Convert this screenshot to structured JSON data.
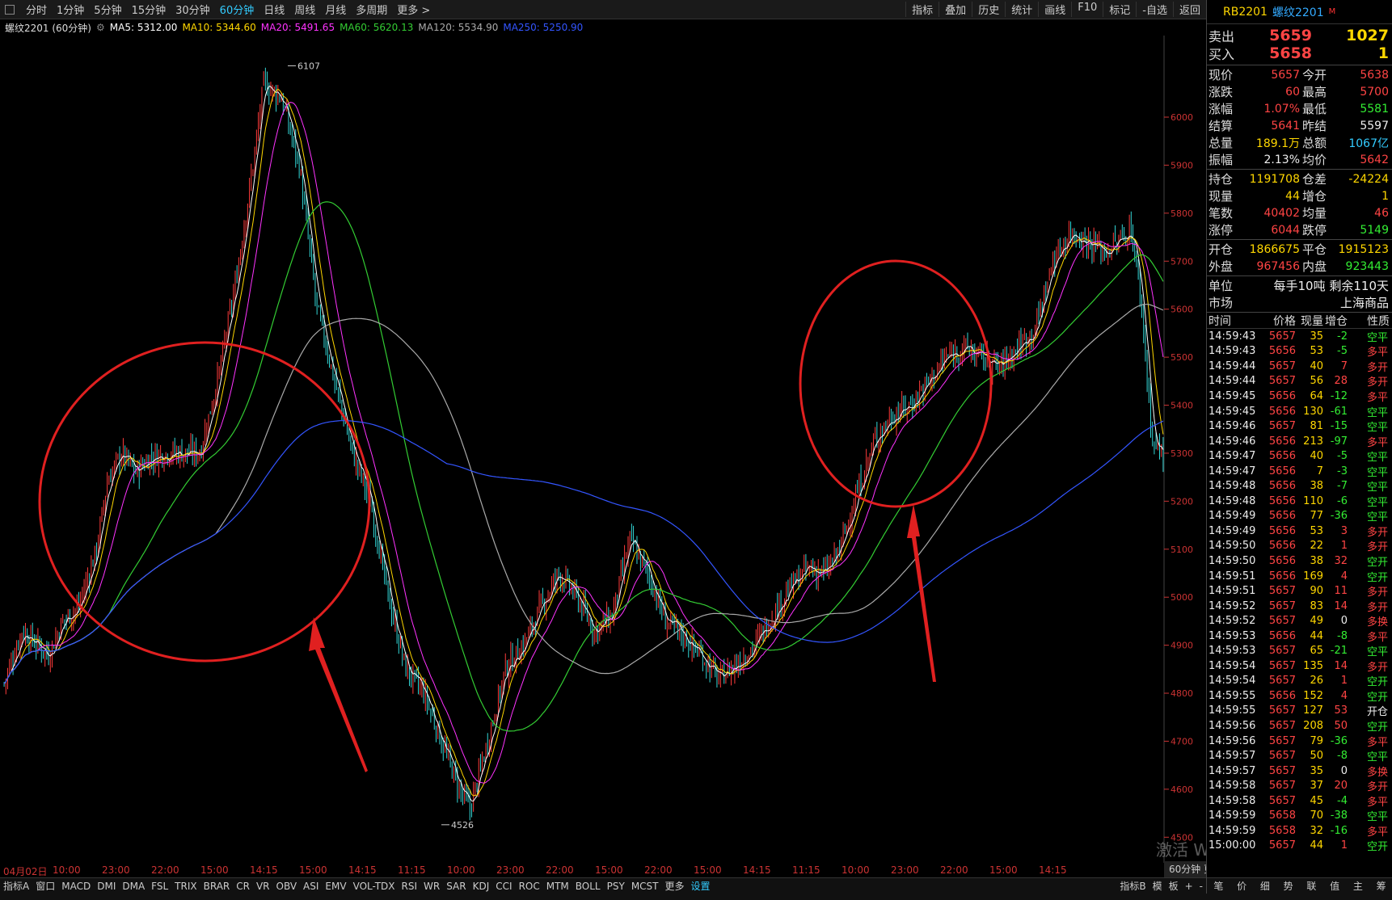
{
  "toolbar": {
    "timeframes": [
      "分时",
      "1分钟",
      "5分钟",
      "15分钟",
      "30分钟",
      "60分钟",
      "日线",
      "周线",
      "月线",
      "多周期",
      "更多 >"
    ],
    "active_timeframe": "60分钟",
    "tools": [
      "指标",
      "叠加",
      "历史",
      "统计",
      "画线",
      "F10",
      "标记",
      "-自选",
      "返回"
    ]
  },
  "infobar": {
    "symbol": "螺纹2201 (60分钟)",
    "ma5": "MA5: 5312.00",
    "ma10": "MA10: 5344.60",
    "ma20": "MA20: 5491.65",
    "ma60": "MA60: 5620.13",
    "ma120": "MA120: 5534.90",
    "ma250": "MA250: 5250.90",
    "colors": {
      "ma5": "#ffffff",
      "ma10": "#ffd700",
      "ma20": "#ff33ff",
      "ma60": "#33cc33",
      "ma120": "#aaaaaa",
      "ma250": "#3355ff"
    }
  },
  "chart_data": {
    "type": "candlestick",
    "ylim": [
      4450,
      6170
    ],
    "yticks": [
      4500,
      4600,
      4700,
      4800,
      4900,
      5000,
      5100,
      5200,
      5300,
      5400,
      5500,
      5600,
      5700,
      5800,
      5900,
      6000
    ],
    "xticks": [
      "04月02日",
      "10:00",
      "23:00",
      "22:00",
      "15:00",
      "14:15",
      "15:00",
      "14:15",
      "11:15",
      "10:00",
      "23:00",
      "22:00",
      "15:00",
      "22:00",
      "15:00",
      "14:15",
      "11:15",
      "10:00",
      "23:00",
      "22:00",
      "15:00",
      "14:15"
    ],
    "close_path": [
      [
        0,
        4820
      ],
      [
        10,
        4930
      ],
      [
        25,
        4880
      ],
      [
        33,
        4950
      ],
      [
        42,
        4980
      ],
      [
        52,
        5100
      ],
      [
        58,
        5240
      ],
      [
        66,
        5300
      ],
      [
        74,
        5260
      ],
      [
        82,
        5290
      ],
      [
        92,
        5300
      ],
      [
        110,
        5300
      ],
      [
        120,
        5450
      ],
      [
        130,
        5650
      ],
      [
        140,
        5900
      ],
      [
        146,
        6070
      ],
      [
        156,
        6040
      ],
      [
        166,
        5900
      ],
      [
        176,
        5600
      ],
      [
        186,
        5450
      ],
      [
        196,
        5300
      ],
      [
        206,
        5200
      ],
      [
        216,
        5000
      ],
      [
        226,
        4850
      ],
      [
        236,
        4800
      ],
      [
        246,
        4700
      ],
      [
        256,
        4600
      ],
      [
        262,
        4560
      ],
      [
        272,
        4700
      ],
      [
        282,
        4850
      ],
      [
        292,
        4900
      ],
      [
        302,
        4980
      ],
      [
        312,
        5050
      ],
      [
        322,
        5000
      ],
      [
        332,
        4930
      ],
      [
        342,
        4960
      ],
      [
        352,
        5120
      ],
      [
        362,
        5050
      ],
      [
        372,
        4950
      ],
      [
        382,
        4920
      ],
      [
        392,
        4880
      ],
      [
        402,
        4830
      ],
      [
        412,
        4860
      ],
      [
        422,
        4900
      ],
      [
        432,
        4960
      ],
      [
        442,
        5020
      ],
      [
        452,
        5060
      ],
      [
        462,
        5050
      ],
      [
        470,
        5100
      ],
      [
        480,
        5220
      ],
      [
        490,
        5330
      ],
      [
        500,
        5380
      ],
      [
        510,
        5400
      ],
      [
        520,
        5450
      ],
      [
        530,
        5500
      ],
      [
        540,
        5520
      ],
      [
        550,
        5500
      ],
      [
        560,
        5480
      ],
      [
        570,
        5520
      ],
      [
        580,
        5560
      ],
      [
        590,
        5700
      ],
      [
        600,
        5760
      ],
      [
        610,
        5740
      ],
      [
        620,
        5720
      ],
      [
        630,
        5750
      ],
      [
        634,
        5770
      ],
      [
        640,
        5600
      ],
      [
        646,
        5320
      ],
      [
        652,
        5300
      ]
    ],
    "price_labels": [
      {
        "text": "6107"
      },
      {
        "text": "4526"
      }
    ],
    "series": [
      {
        "name": "MA5",
        "color": "#ffffff"
      },
      {
        "name": "MA10",
        "color": "#ffd700"
      },
      {
        "name": "MA20",
        "color": "#ff33ff"
      },
      {
        "name": "MA60",
        "color": "#33cc33"
      },
      {
        "name": "MA120",
        "color": "#aaaaaa"
      },
      {
        "name": "MA250",
        "color": "#3355ff"
      }
    ]
  },
  "timeframe_badge": "60分钟 更",
  "bottom_tabs": [
    "指标A",
    "窗口",
    "MACD",
    "DMI",
    "DMA",
    "FSL",
    "TRIX",
    "BRAR",
    "CR",
    "VR",
    "OBV",
    "ASI",
    "EMV",
    "VOL-TDX",
    "RSI",
    "WR",
    "SAR",
    "KDJ",
    "CCI",
    "ROC",
    "MTM",
    "BOLL",
    "PSY",
    "MCST",
    "更多",
    "设置"
  ],
  "bottom_right": [
    "指标B",
    "模",
    "板",
    "+",
    "-"
  ],
  "watermark": "激活 Windows",
  "panel": {
    "code": "RB2201",
    "name": "螺纹2201",
    "market_flag": "M",
    "sell_label": "卖出",
    "sell_price": "5659",
    "sell_vol": "1027",
    "buy_label": "买入",
    "buy_price": "5658",
    "buy_vol": "1",
    "quote_rows": [
      {
        "l1": "现价",
        "v1": "5657",
        "c1": "red",
        "l2": "今开",
        "v2": "5638",
        "c2": "red"
      },
      {
        "l1": "涨跌",
        "v1": "60",
        "c1": "red",
        "l2": "最高",
        "v2": "5700",
        "c2": "red"
      },
      {
        "l1": "涨幅",
        "v1": "1.07%",
        "c1": "red",
        "l2": "最低",
        "v2": "5581",
        "c2": "green"
      },
      {
        "l1": "结算",
        "v1": "5641",
        "c1": "red",
        "l2": "昨结",
        "v2": "5597",
        "c2": "white"
      },
      {
        "l1": "总量",
        "v1": "189.1万",
        "c1": "yellow",
        "l2": "总额",
        "v2": "1067亿",
        "c2": "cyan"
      },
      {
        "l1": "振幅",
        "v1": "2.13%",
        "c1": "white",
        "l2": "均价",
        "v2": "5642",
        "c2": "red"
      }
    ],
    "position_rows": [
      {
        "l1": "持仓",
        "v1": "1191708",
        "c1": "yellow",
        "l2": "仓差",
        "v2": "-24224",
        "c2": "yellow"
      },
      {
        "l1": "现量",
        "v1": "44",
        "c1": "yellow",
        "l2": "增仓",
        "v2": "1",
        "c2": "yellow"
      },
      {
        "l1": "笔数",
        "v1": "40402",
        "c1": "red",
        "l2": "均量",
        "v2": "46",
        "c2": "red"
      },
      {
        "l1": "涨停",
        "v1": "6044",
        "c1": "red",
        "l2": "跌停",
        "v2": "5149",
        "c2": "green"
      }
    ],
    "flow_rows": [
      {
        "l1": "开仓",
        "v1": "1866675",
        "c1": "yellow",
        "l2": "平仓",
        "v2": "1915123",
        "c2": "yellow"
      },
      {
        "l1": "外盘",
        "v1": "967456",
        "c1": "red",
        "l2": "内盘",
        "v2": "923443",
        "c2": "green"
      }
    ],
    "unit_label": "单位",
    "unit_value": "每手10吨  剩余110天",
    "market_label": "市场",
    "market_value": "上海商品",
    "ticks_header": [
      "时间",
      "价格",
      "现量",
      "增仓",
      "性质"
    ],
    "ticks": [
      {
        "t": "14:59:43",
        "p": "5657",
        "q": "35",
        "d": "-2",
        "n": "空平"
      },
      {
        "t": "14:59:43",
        "p": "5656",
        "q": "53",
        "d": "-5",
        "n": "多平"
      },
      {
        "t": "14:59:44",
        "p": "5657",
        "q": "40",
        "d": "7",
        "n": "多开"
      },
      {
        "t": "14:59:44",
        "p": "5657",
        "q": "56",
        "d": "28",
        "n": "多开"
      },
      {
        "t": "14:59:45",
        "p": "5656",
        "q": "64",
        "d": "-12",
        "n": "多平"
      },
      {
        "t": "14:59:45",
        "p": "5656",
        "q": "130",
        "d": "-61",
        "n": "空平"
      },
      {
        "t": "14:59:46",
        "p": "5657",
        "q": "81",
        "d": "-15",
        "n": "空平"
      },
      {
        "t": "14:59:46",
        "p": "5656",
        "q": "213",
        "d": "-97",
        "n": "多平"
      },
      {
        "t": "14:59:47",
        "p": "5656",
        "q": "40",
        "d": "-5",
        "n": "空平"
      },
      {
        "t": "14:59:47",
        "p": "5656",
        "q": "7",
        "d": "-3",
        "n": "空平"
      },
      {
        "t": "14:59:48",
        "p": "5656",
        "q": "38",
        "d": "-7",
        "n": "空平"
      },
      {
        "t": "14:59:48",
        "p": "5656",
        "q": "110",
        "d": "-6",
        "n": "空平"
      },
      {
        "t": "14:59:49",
        "p": "5656",
        "q": "77",
        "d": "-36",
        "n": "空平"
      },
      {
        "t": "14:59:49",
        "p": "5656",
        "q": "53",
        "d": "3",
        "n": "多开"
      },
      {
        "t": "14:59:50",
        "p": "5656",
        "q": "22",
        "d": "1",
        "n": "多开"
      },
      {
        "t": "14:59:50",
        "p": "5656",
        "q": "38",
        "d": "32",
        "n": "空开"
      },
      {
        "t": "14:59:51",
        "p": "5656",
        "q": "169",
        "d": "4",
        "n": "空开"
      },
      {
        "t": "14:59:51",
        "p": "5657",
        "q": "90",
        "d": "11",
        "n": "多开"
      },
      {
        "t": "14:59:52",
        "p": "5657",
        "q": "83",
        "d": "14",
        "n": "多开"
      },
      {
        "t": "14:59:52",
        "p": "5657",
        "q": "49",
        "d": "0",
        "n": "多换"
      },
      {
        "t": "14:59:53",
        "p": "5656",
        "q": "44",
        "d": "-8",
        "n": "多平"
      },
      {
        "t": "14:59:53",
        "p": "5657",
        "q": "65",
        "d": "-21",
        "n": "空平"
      },
      {
        "t": "14:59:54",
        "p": "5657",
        "q": "135",
        "d": "14",
        "n": "多开"
      },
      {
        "t": "14:59:54",
        "p": "5657",
        "q": "26",
        "d": "1",
        "n": "空开"
      },
      {
        "t": "14:59:55",
        "p": "5656",
        "q": "152",
        "d": "4",
        "n": "空开"
      },
      {
        "t": "14:59:55",
        "p": "5657",
        "q": "127",
        "d": "53",
        "n": "开仓"
      },
      {
        "t": "14:59:56",
        "p": "5657",
        "q": "208",
        "d": "50",
        "n": "空开"
      },
      {
        "t": "14:59:56",
        "p": "5657",
        "q": "79",
        "d": "-36",
        "n": "多平"
      },
      {
        "t": "14:59:57",
        "p": "5657",
        "q": "50",
        "d": "-8",
        "n": "空平"
      },
      {
        "t": "14:59:57",
        "p": "5657",
        "q": "35",
        "d": "0",
        "n": "多换"
      },
      {
        "t": "14:59:58",
        "p": "5657",
        "q": "37",
        "d": "20",
        "n": "多开"
      },
      {
        "t": "14:59:58",
        "p": "5657",
        "q": "45",
        "d": "-4",
        "n": "多平"
      },
      {
        "t": "14:59:59",
        "p": "5658",
        "q": "70",
        "d": "-38",
        "n": "空平"
      },
      {
        "t": "14:59:59",
        "p": "5658",
        "q": "32",
        "d": "-16",
        "n": "多平"
      },
      {
        "t": "15:00:00",
        "p": "5657",
        "q": "44",
        "d": "1",
        "n": "空开"
      }
    ],
    "foot": [
      "笔",
      "价",
      "细",
      "势",
      "联",
      "值",
      "主",
      "筹"
    ]
  }
}
